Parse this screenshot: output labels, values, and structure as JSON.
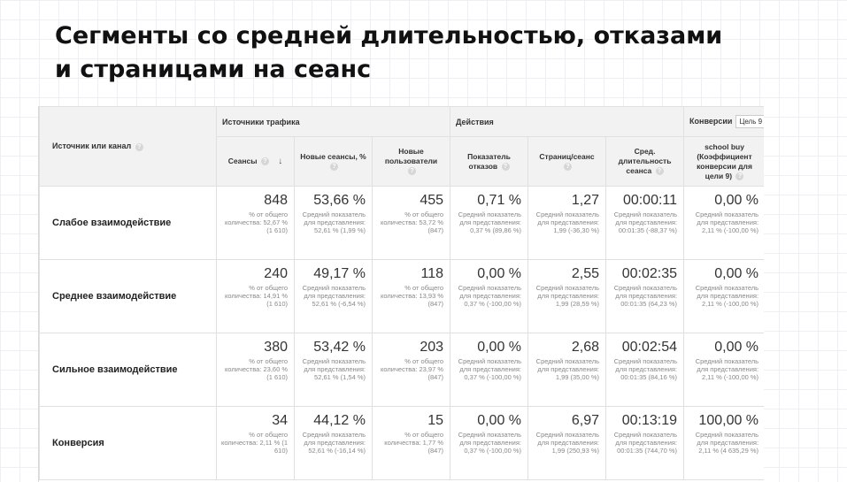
{
  "slide": {
    "title_line1": "Сегменты со средней длительностью, отказами",
    "title_line2": "и страницами на сеанс"
  },
  "table": {
    "dimension_header": "Источник или канал",
    "groups": {
      "traffic": "Источники трафика",
      "actions": "Действия",
      "conversions": "Конверсии",
      "goal_select": "Цель 9"
    },
    "columns": [
      "Сеансы",
      "Новые сеансы, %",
      "Новые пользователи",
      "Показатель отказов",
      "Страниц/сеанс",
      "Сред. длительность сеанса",
      "school buy (Коэффициент конверсии для цели 9)"
    ],
    "rows": [
      {
        "segment": "Слабое взаимодействие",
        "cells": [
          {
            "value": "848",
            "sub": "% от общего количества: 52,67 % (1 610)"
          },
          {
            "value": "53,66 %",
            "sub": "Средний показатель для представления: 52,61 % (1,99 %)"
          },
          {
            "value": "455",
            "sub": "% от общего количества: 53,72 % (847)"
          },
          {
            "value": "0,71 %",
            "sub": "Средний показатель для представления: 0,37 % (89,86 %)"
          },
          {
            "value": "1,27",
            "sub": "Средний показатель для представления: 1,99 (-36,30 %)"
          },
          {
            "value": "00:00:11",
            "sub": "Средний показатель для представления: 00:01:35 (-88,37 %)"
          },
          {
            "value": "0,00 %",
            "sub": "Средний показатель для представления: 2,11 % (-100,00 %)"
          }
        ]
      },
      {
        "segment": "Среднее взаимодействие",
        "cells": [
          {
            "value": "240",
            "sub": "% от общего количества: 14,91 % (1 610)"
          },
          {
            "value": "49,17 %",
            "sub": "Средний показатель для представления: 52,61 % (-6,54 %)"
          },
          {
            "value": "118",
            "sub": "% от общего количества: 13,93 % (847)"
          },
          {
            "value": "0,00 %",
            "sub": "Средний показатель для представления: 0,37 % (-100,00 %)"
          },
          {
            "value": "2,55",
            "sub": "Средний показатель для представления: 1,99 (28,59 %)"
          },
          {
            "value": "00:02:35",
            "sub": "Средний показатель для представления: 00:01:35 (64,23 %)"
          },
          {
            "value": "0,00 %",
            "sub": "Средний показатель для представления: 2,11 % (-100,00 %)"
          }
        ]
      },
      {
        "segment": "Сильное взаимодействие",
        "cells": [
          {
            "value": "380",
            "sub": "% от общего количества: 23,60 % (1 610)"
          },
          {
            "value": "53,42 %",
            "sub": "Средний показатель для представления: 52,61 % (1,54 %)"
          },
          {
            "value": "203",
            "sub": "% от общего количества: 23,97 % (847)"
          },
          {
            "value": "0,00 %",
            "sub": "Средний показатель для представления: 0,37 % (-100,00 %)"
          },
          {
            "value": "2,68",
            "sub": "Средний показатель для представления: 1,99 (35,00 %)"
          },
          {
            "value": "00:02:54",
            "sub": "Средний показатель для представления: 00:01:35 (84,16 %)"
          },
          {
            "value": "0,00 %",
            "sub": "Средний показатель для представления: 2,11 % (-100,00 %)"
          }
        ]
      },
      {
        "segment": "Конверсия",
        "cells": [
          {
            "value": "34",
            "sub": "% от общего количества: 2,11 % (1 610)"
          },
          {
            "value": "44,12 %",
            "sub": "Средний показатель для представления: 52,61 % (-16,14 %)"
          },
          {
            "value": "15",
            "sub": "% от общего количества: 1,77 % (847)"
          },
          {
            "value": "0,00 %",
            "sub": "Средний показатель для представления: 0,37 % (-100,00 %)"
          },
          {
            "value": "6,97",
            "sub": "Средний показатель для представления: 1,99 (250,93 %)"
          },
          {
            "value": "00:13:19",
            "sub": "Средний показатель для представления: 00:01:35 (744,70 %)"
          },
          {
            "value": "100,00 %",
            "sub": "Средний показатель для представления: 2,11 % (4 635,29 %)"
          }
        ]
      }
    ]
  }
}
